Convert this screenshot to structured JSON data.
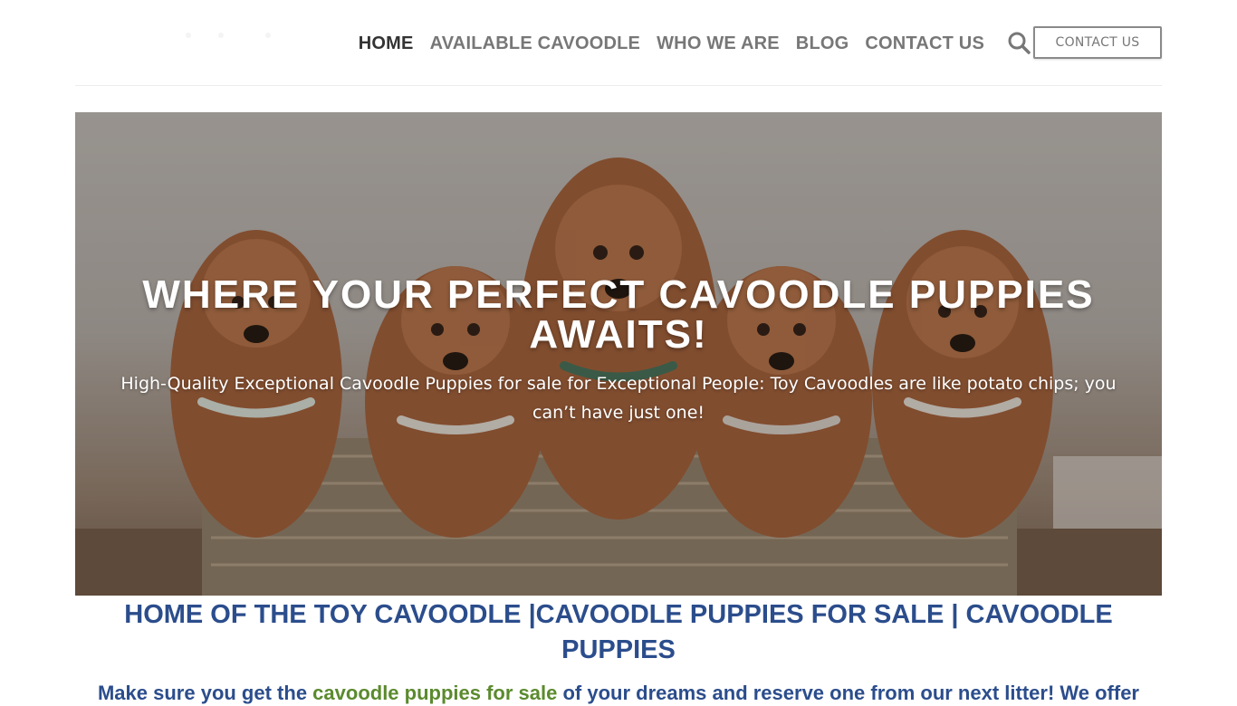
{
  "header": {
    "nav": [
      {
        "label": "HOME",
        "active": true
      },
      {
        "label": "AVAILABLE CAVOODLE",
        "active": false
      },
      {
        "label": "WHO WE ARE",
        "active": false
      },
      {
        "label": "BLOG",
        "active": false
      },
      {
        "label": "CONTACT US",
        "active": false
      }
    ],
    "search_icon": "search-icon",
    "contact_button": "CONTACT US"
  },
  "hero": {
    "title": "WHERE YOUR PERFECT CAVOODLE PUPPIES AWAITS!",
    "subtitle": "High-Quality Exceptional Cavoodle Puppies for sale for Exceptional People: Toy Cavoodles are like potato chips; you can’t have just one!",
    "image": "photo of five red cavoodle puppies in a wicker basket"
  },
  "content": {
    "heading": "HOME OF THE TOY CAVOODLE |CAVOODLE PUPPIES FOR SALE | CAVOODLE PUPPIES",
    "intro_before": "Make sure you get the ",
    "intro_link": "cavoodle puppies for sale",
    "intro_after": " of your dreams and reserve one from our next litter! We offer"
  },
  "colors": {
    "nav_text": "#777777",
    "nav_active": "#333333",
    "heading_blue": "#2b4d8c",
    "link_green": "#5b8a2e"
  }
}
